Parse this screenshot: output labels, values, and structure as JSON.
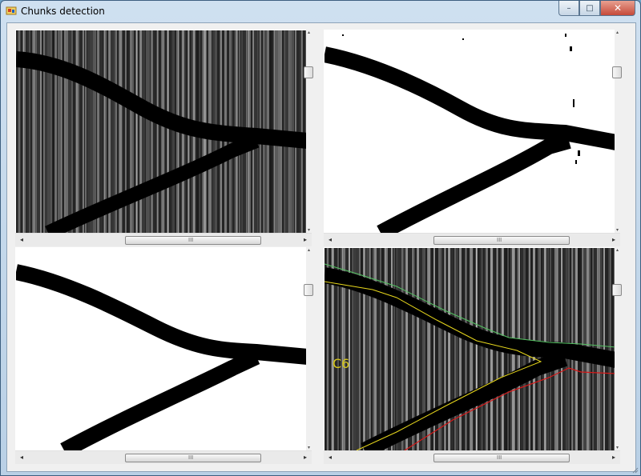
{
  "window": {
    "title": "Chunks detection",
    "controls": {
      "minimize": "–",
      "maximize": "□",
      "close": "✕"
    }
  },
  "icons": {
    "app": "app-icon",
    "minimize": "minimize-icon",
    "maximize": "maximize-icon",
    "close": "close-icon"
  },
  "panes": [
    {
      "id": "grayscale-source",
      "vscroll_up": "▴",
      "vscroll_down": "▾",
      "hscroll_left": "◂",
      "hscroll_right": "▸",
      "grip": "III"
    },
    {
      "id": "binary-threshold",
      "vscroll_up": "▴",
      "vscroll_down": "▾",
      "hscroll_left": "◂",
      "hscroll_right": "▸",
      "grip": "III"
    },
    {
      "id": "binary-cleaned",
      "vscroll_up": "▴",
      "vscroll_down": "▾",
      "hscroll_left": "◂",
      "hscroll_right": "▸",
      "grip": "III"
    },
    {
      "id": "detected-overlay",
      "vscroll_up": "▴",
      "vscroll_down": "▾",
      "hscroll_left": "◂",
      "hscroll_right": "▸",
      "grip": "III",
      "chunk_label": "C6"
    }
  ],
  "colors": {
    "contour_upper": "#52c060",
    "contour_lower": "#d81818",
    "contour_chunk": "#e8d81c",
    "chunk_label": "#d8c81a"
  }
}
